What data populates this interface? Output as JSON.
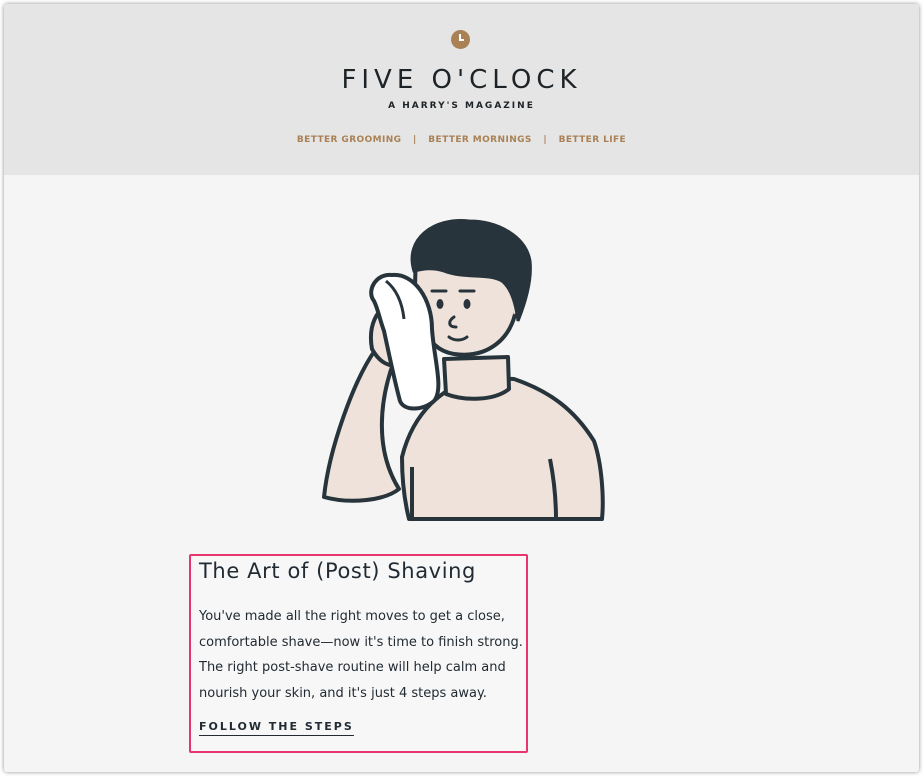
{
  "header": {
    "brand": "FIVE O'CLOCK",
    "tagline": "A HARRY'S MAGAZINE",
    "nav": [
      "BETTER GROOMING",
      "BETTER MORNINGS",
      "BETTER LIFE"
    ],
    "nav_separator": "|"
  },
  "article": {
    "title": "The Art of (Post) Shaving",
    "body": "You've made all the right moves to get a close, comfortable shave—now it's time to finish strong. The right post-shave routine will help calm and nourish your skin, and it's just 4 steps away.",
    "cta_label": "FOLLOW THE STEPS"
  },
  "colors": {
    "accent": "#a98155",
    "highlight_border": "#e8356d",
    "header_bg": "#e5e5e5",
    "page_bg": "#f5f5f5",
    "text": "#222b33"
  },
  "icons": {
    "logo": "clock-icon",
    "hero": "man-drying-face-with-towel-illustration"
  }
}
